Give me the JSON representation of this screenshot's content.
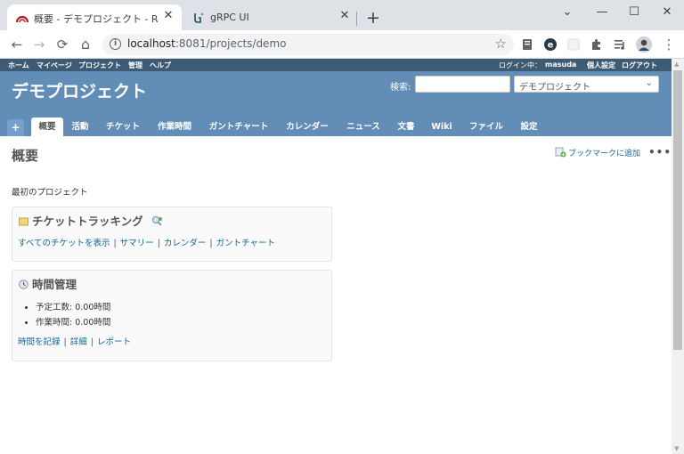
{
  "browser": {
    "tabs": [
      {
        "title": "概要 - デモプロジェクト - Redmine",
        "close": "✕"
      },
      {
        "title": "gRPC UI",
        "close": "✕"
      }
    ],
    "new_tab": "+",
    "window_controls": {
      "minimize": "—",
      "maximize": "☐",
      "close": "✕",
      "expand": "⌄"
    },
    "url_host": "localhost",
    "url_path": ":8081/projects/demo",
    "nav": {
      "back": "←",
      "forward": "→",
      "reload": "⟳",
      "home": "⌂"
    },
    "menu": "⋮"
  },
  "top_menu": {
    "items": [
      "ホーム",
      "マイページ",
      "プロジェクト",
      "管理",
      "ヘルプ"
    ],
    "login_label": "ログイン中：",
    "user": "masuda",
    "my_account": "個人設定",
    "logout": "ログアウト"
  },
  "header": {
    "project_title": "デモプロジェクト",
    "search_label": "検索:",
    "search_value": "",
    "project_jump": "デモプロジェクト"
  },
  "main_menu": {
    "plus": "+",
    "tabs": [
      "概要",
      "活動",
      "チケット",
      "作業時間",
      "ガントチャート",
      "カレンダー",
      "ニュース",
      "文書",
      "Wiki",
      "ファイル",
      "設定"
    ],
    "selected": "概要"
  },
  "content": {
    "page_title": "概要",
    "bookmark": "ブックマークに追加",
    "more": "•••",
    "description": "最初のプロジェクト",
    "issue_tracking": {
      "title": "チケットトラッキング",
      "links": [
        "すべてのチケットを表示",
        "サマリー",
        "カレンダー",
        "ガントチャート"
      ]
    },
    "spent_time": {
      "title": "時間管理",
      "items": [
        "予定工数: 0.00時間",
        "作業時間: 0.00時間"
      ],
      "links": [
        "時間を記録",
        "詳細",
        "レポート"
      ]
    }
  },
  "colors": {
    "header_bg": "#628db6",
    "top_menu_bg": "#3e5b76",
    "link": "#116699"
  }
}
